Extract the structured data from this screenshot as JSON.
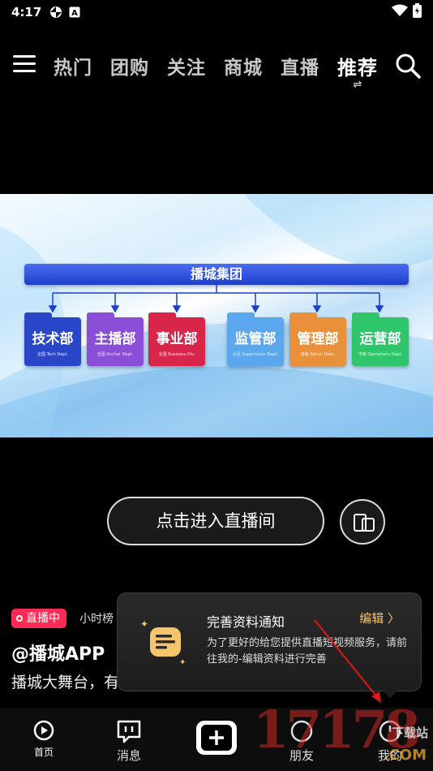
{
  "status_bar": {
    "time": "4:17",
    "icons": [
      "pinwheel-icon",
      "a-icon",
      "wifi-icon",
      "battery-icon"
    ]
  },
  "top_nav": {
    "tabs": [
      {
        "label": "热门",
        "active": false
      },
      {
        "label": "团购",
        "active": false
      },
      {
        "label": "关注",
        "active": false
      },
      {
        "label": "商城",
        "active": false
      },
      {
        "label": "直播",
        "active": false
      },
      {
        "label": "推荐",
        "active": true
      }
    ],
    "swap_symbol": "⇌"
  },
  "banner": {
    "group_title": "播城集团",
    "departments": [
      {
        "name": "技术部",
        "sub": "全国 Tech Dept.",
        "color": "#2a46c8"
      },
      {
        "name": "主播部",
        "sub": "全国 Anchor Dept.",
        "color": "#8a4fd6"
      },
      {
        "name": "事业部",
        "sub": "全国 Business Div.",
        "color": "#d8264a"
      },
      {
        "name": "监管部",
        "sub": "大区 Supervision Dept.",
        "color": "#5aa7ee"
      },
      {
        "name": "管理部",
        "sub": "省级 Admin Dept.",
        "color": "#e8913a"
      },
      {
        "name": "运营部",
        "sub": "市级 Operations Dept.",
        "color": "#2fc56b"
      }
    ]
  },
  "live": {
    "enter_label": "点击进入直播间",
    "badge": "直播中",
    "rank": "小时榜",
    "anchor": "@播城APP",
    "description": "播城大舞台，有"
  },
  "popup": {
    "title": "完善资料通知",
    "edit": "编辑 〉",
    "message": "为了更好的给您提供直播短视频服务，请前往我的-编辑资料进行完善"
  },
  "bottom_nav": {
    "home": "首页",
    "messages": "消息",
    "friends": "朋友",
    "me": "我的"
  },
  "watermark": {
    "number": "17178",
    "top": "下载站",
    "com": ".COM"
  }
}
